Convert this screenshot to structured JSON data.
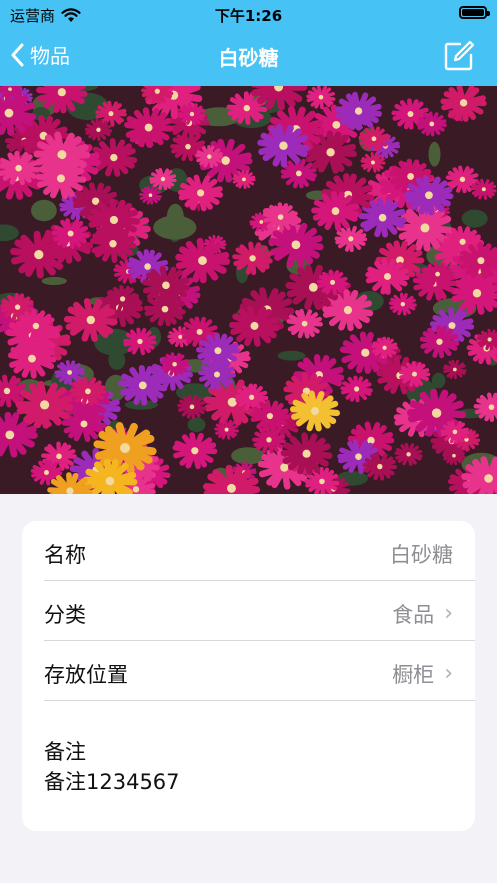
{
  "status": {
    "carrier": "运营商",
    "time": "下午1:26",
    "battery_level": 1.0
  },
  "nav": {
    "back_label": "物品",
    "title": "白砂糖"
  },
  "item": {
    "name_label": "名称",
    "name_value": "白砂糖",
    "category_label": "分类",
    "category_value": "食品",
    "location_label": "存放位置",
    "location_value": "橱柜",
    "notes_label": "备注",
    "notes_value": "备注1234567"
  },
  "colors": {
    "nav_bg": "#47c2f5",
    "page_bg": "#f2f2f7"
  },
  "icons": {
    "back": "chevron-left-icon",
    "edit": "compose-icon",
    "wifi": "wifi-icon",
    "disclosure": "chevron-right-icon"
  }
}
